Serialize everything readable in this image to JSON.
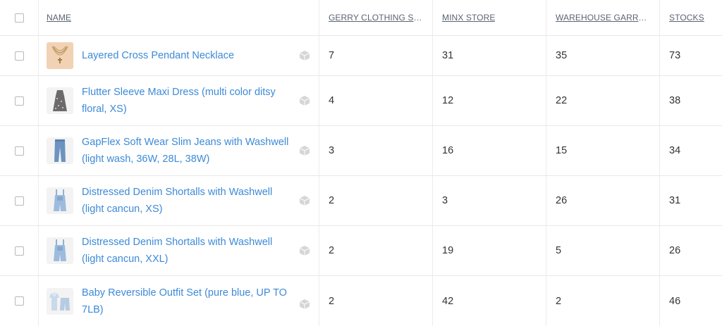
{
  "header": {
    "name": "NAME",
    "col1": "GERRY CLOTHING ST...",
    "col2": "MINX STORE",
    "col3": "WAREHOUSE GARRY ...",
    "col4": "STOCKS"
  },
  "rows": [
    {
      "name": "Layered Cross Pendant Necklace",
      "thumb": "necklace-thumb",
      "gerry": "7",
      "minx": "31",
      "warehouse": "35",
      "stocks": "73"
    },
    {
      "name": "Flutter Sleeve Maxi Dress (multi color ditsy floral, XS)",
      "thumb": "dress-thumb",
      "gerry": "4",
      "minx": "12",
      "warehouse": "22",
      "stocks": "38"
    },
    {
      "name": "GapFlex Soft Wear Slim Jeans with Washwell (light wash, 36W, 28L, 38W)",
      "thumb": "jeans-thumb",
      "gerry": "3",
      "minx": "16",
      "warehouse": "15",
      "stocks": "34"
    },
    {
      "name": "Distressed Denim Shortalls with Washwell (light cancun, XS)",
      "thumb": "shortalls-thumb",
      "gerry": "2",
      "minx": "3",
      "warehouse": "26",
      "stocks": "31"
    },
    {
      "name": "Distressed Denim Shortalls with Washwell (light cancun, XXL)",
      "thumb": "shortalls-thumb",
      "gerry": "2",
      "minx": "19",
      "warehouse": "5",
      "stocks": "26"
    },
    {
      "name": "Baby Reversible Outfit Set (pure blue, UP TO 7LB)",
      "thumb": "baby-outfit-thumb",
      "gerry": "2",
      "minx": "42",
      "warehouse": "2",
      "stocks": "46"
    }
  ],
  "colors": {
    "link": "#3d8ad8",
    "header_text": "#5b6472",
    "border": "#e8e8e8"
  }
}
